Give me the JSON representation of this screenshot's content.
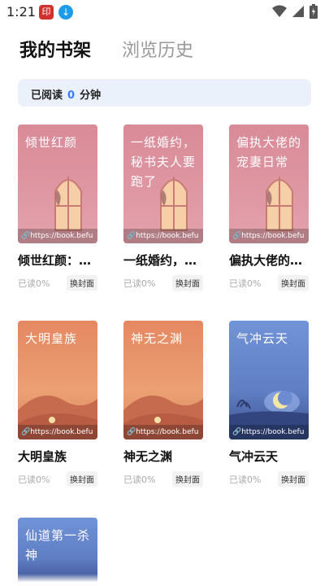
{
  "status_bar": {
    "time": "1:21"
  },
  "tabs": {
    "bookshelf": "我的书架",
    "history": "浏览历史"
  },
  "reading": {
    "prefix": "已阅读",
    "minutes": "0",
    "suffix": "分钟"
  },
  "change_cover_label": "换封面",
  "books": [
    {
      "cover_title": "倾世红颜",
      "url": "https://book.befu",
      "name": "倾世红颜：…",
      "progress": "已读0%",
      "style": "pink"
    },
    {
      "cover_title": "一纸婚约，秘书夫人要跑了",
      "url": "https://book.befu",
      "name": "一纸婚约，…",
      "progress": "已读0%",
      "style": "pink"
    },
    {
      "cover_title": "偏执大佬的宠妻日常",
      "url": "https://book.befu",
      "name": "偏执大佬的…",
      "progress": "已读0%",
      "style": "pink"
    },
    {
      "cover_title": "大明皇族",
      "url": "https://book.befu",
      "name": "大明皇族",
      "progress": "已读0%",
      "style": "orange"
    },
    {
      "cover_title": "神无之渊",
      "url": "https://book.befu",
      "name": "神无之渊",
      "progress": "已读0%",
      "style": "orange"
    },
    {
      "cover_title": "气冲云天",
      "url": "https://book.befu",
      "name": "气冲云天",
      "progress": "已读0%",
      "style": "blue"
    },
    {
      "cover_title": "仙道第一杀神",
      "style": "blue"
    }
  ],
  "icons": [
    "app-notification-icon",
    "download-icon",
    "wifi-icon",
    "signal-icon",
    "battery-icon",
    "link-icon"
  ]
}
